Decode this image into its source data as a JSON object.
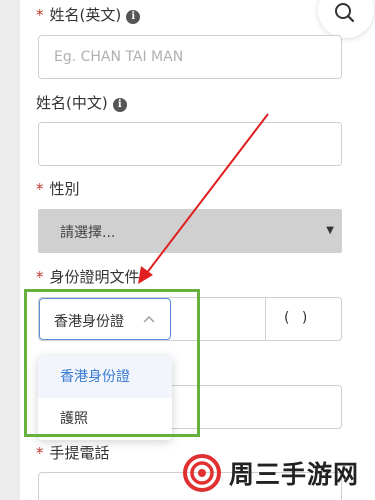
{
  "form": {
    "name_en": {
      "required_mark": "*",
      "label": "姓名(英文)",
      "info_glyph": "i",
      "placeholder": "Eg. CHAN TAI MAN"
    },
    "name_zh": {
      "label": "姓名(中文)",
      "info_glyph": "i"
    },
    "gender": {
      "required_mark": "*",
      "label": "性別",
      "selected": "請選擇..."
    },
    "id_doc": {
      "required_mark": "*",
      "label": "身份證明文件",
      "selected_type": "香港身份證",
      "check_digit": "( )",
      "options": [
        {
          "label": "香港身份證",
          "selected": true
        },
        {
          "label": "護照",
          "selected": false
        }
      ]
    },
    "mobile": {
      "required_mark": "*",
      "label": "手提電話"
    }
  },
  "icons": {
    "search": "search-icon",
    "info": "info-icon",
    "caret": "caret-down-icon",
    "chevron": "chevron-up-icon"
  },
  "annotation": {
    "arrow_color": "#e02020",
    "highlight_color": "#66b03f"
  },
  "watermark": {
    "text": "周三手游网"
  }
}
